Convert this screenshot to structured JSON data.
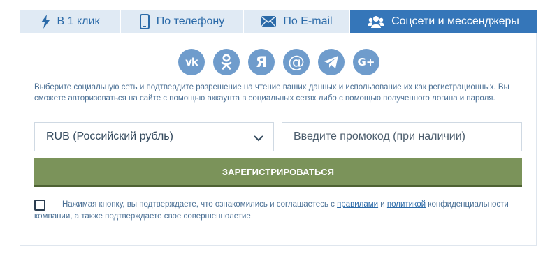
{
  "tabs": [
    {
      "label": "В 1 клик",
      "icon": "lightning-icon"
    },
    {
      "label": "По телефону",
      "icon": "phone-icon"
    },
    {
      "label": "По E-mail",
      "icon": "envelope-icon"
    },
    {
      "label": "Соцсети и мессенджеры",
      "icon": "users-icon",
      "active": true
    }
  ],
  "socials": [
    {
      "name": "vk-icon",
      "glyph": "vk"
    },
    {
      "name": "odnoklassniki-icon",
      "glyph": "ok"
    },
    {
      "name": "yandex-icon",
      "glyph": "Я"
    },
    {
      "name": "mailru-icon",
      "glyph": "@"
    },
    {
      "name": "telegram-icon",
      "glyph": "tg"
    },
    {
      "name": "google-plus-icon",
      "glyph": "G+"
    }
  ],
  "info_text": "Выберите социальную сеть и подтвердите разрешение на чтение ваших данных и использование их как регистрационных. Вы сможете авторизоваться на сайте с помощью аккаунта в социальных сетях либо с помощью полученного логина и пароля.",
  "currency": {
    "selected": "RUB (Российский рубль)"
  },
  "promo": {
    "placeholder": "Введите промокод (при наличии)",
    "value": ""
  },
  "register_label": "ЗАРЕГИСТРИРОВАТЬСЯ",
  "agreement": {
    "checked": false,
    "text_before": "Нажимая кнопку, вы подтверждаете, что ознакомились и соглашаетесь с ",
    "link_rules": "правилами",
    "text_and": " и ",
    "link_policy": "политикой",
    "text_after": " конфиденциальности компании, а также подтверждаете свое совершеннолетие"
  },
  "colors": {
    "tab_active_bg": "#3576b9",
    "tab_bg": "#e0eaf4",
    "social_bg": "#6f9ccc",
    "register_bg": "#7b935a",
    "text_blue": "#4a6f94"
  }
}
